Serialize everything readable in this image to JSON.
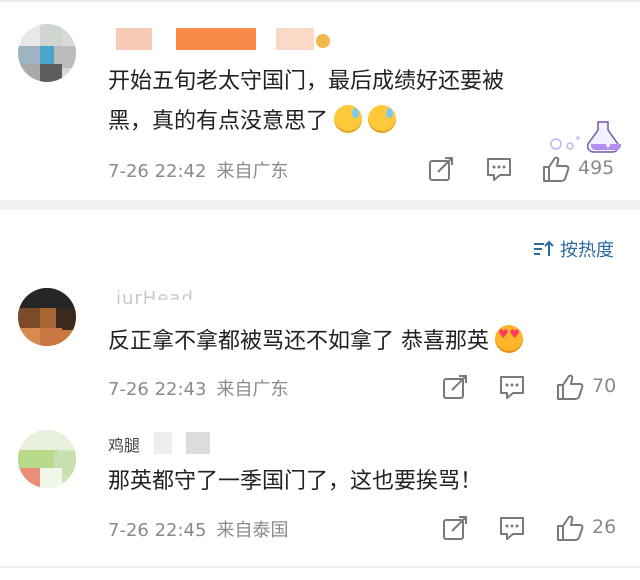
{
  "comments": [
    {
      "text": "开始五旬老太守国门，最后成绩好还要被黑，真的有点没意思了",
      "text_line1": "开始五旬老太守国门，最后成绩好还要被",
      "text_line2": "黑，真的有点没意思了",
      "emoji": [
        "sweat-face-emoji",
        "sweat-face-emoji"
      ],
      "date": "7-26 22:42",
      "source": "来自广东",
      "likes": "495"
    },
    {
      "username_partial": "iurHead",
      "text": "反正拿不拿都被骂还不如拿了 恭喜那英",
      "emoji": [
        "heart-eyes-emoji"
      ],
      "date": "7-26 22:43",
      "source": "来自广东",
      "likes": "70"
    },
    {
      "username_partial": "鸡腿",
      "text": "那英都守了一季国门了，这也要挨骂！",
      "date": "7-26 22:45",
      "source": "来自泰国",
      "likes": "26"
    }
  ],
  "sort": {
    "label": "按热度",
    "icon": "sort-icon"
  },
  "colors": {
    "link": "#2d6a9e",
    "meta": "#8a8a8a",
    "text": "#222222",
    "divider": "#f1f1f1"
  }
}
